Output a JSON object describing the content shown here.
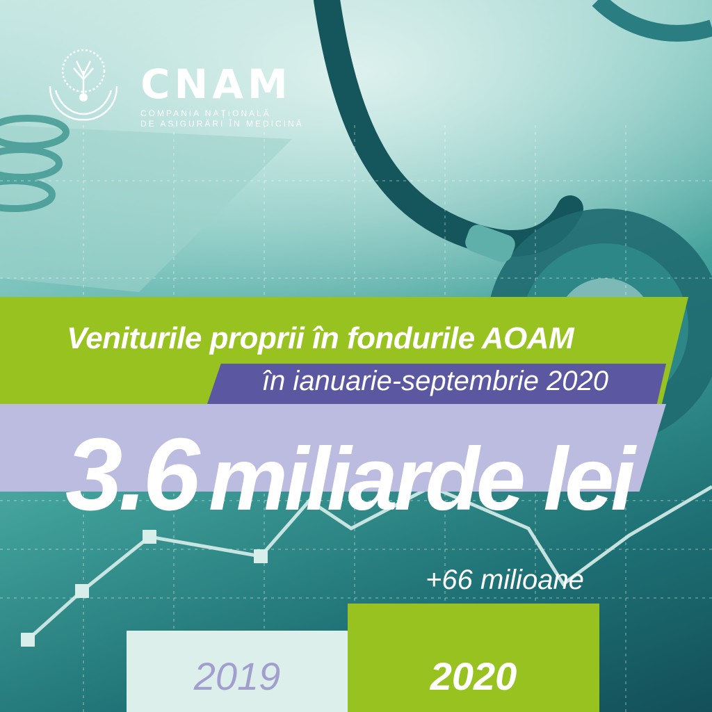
{
  "brand": {
    "name": "CNAM",
    "subtitle_line1": "COMPANIA  NAȚIONALĂ",
    "subtitle_line2": "DE ASIGURĂRI ÎN MEDICINĂ",
    "logo_icon": "tree-in-hands-icon"
  },
  "headline": {
    "title": "Veniturile proprii în fondurile AOAM",
    "period": "în ianuarie-septembrie 2020",
    "value": "3.6",
    "unit": "miliarde lei",
    "increase": "+66 milioane"
  },
  "chart_data": {
    "type": "bar",
    "categories": [
      "2019",
      "2020"
    ]
  },
  "colors": {
    "green": "#97c21f",
    "purple": "#5b57a1",
    "lavender": "#bcbce0",
    "teal": "#1d6f73"
  },
  "background_icons": [
    "stethoscope-icon",
    "notebook-icon",
    "line-graph-icon"
  ]
}
